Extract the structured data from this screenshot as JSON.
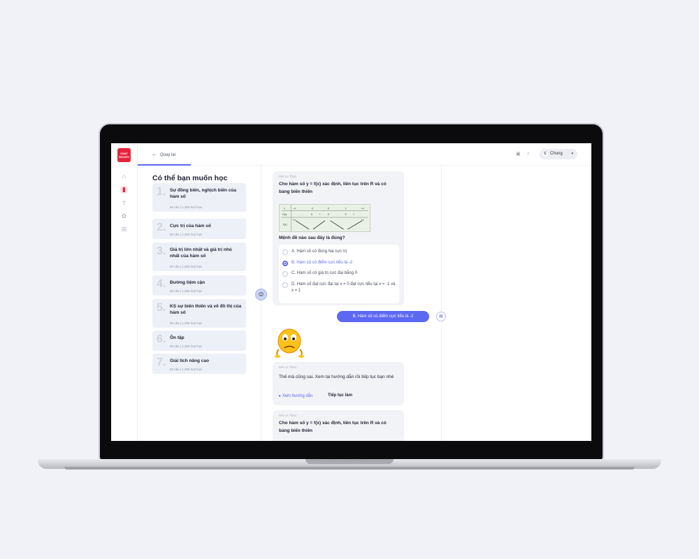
{
  "brand": {
    "logo_line1": "CNAT",
    "logo_line2": "BOOKS"
  },
  "topbar": {
    "back_label": "Quay lại",
    "user_initial": "C",
    "user_name": "Chung",
    "caret": "▾"
  },
  "sidebar": {
    "title": "Có thể bạn muốn học",
    "items": [
      {
        "num": "1.",
        "title": "Sự đồng biến, nghịch biến của hàm số",
        "meta": "50 câu  |  1,250 lượt học"
      },
      {
        "num": "2.",
        "title": "Cực trị của hàm số",
        "meta": "50 câu  |  1,250 lượt học"
      },
      {
        "num": "3.",
        "title": "Giá trị lớn nhất và giá trị nhỏ nhất của hàm số",
        "meta": "50 câu  |  1,250 lượt học"
      },
      {
        "num": "4.",
        "title": "Đường tiệm cận",
        "meta": "50 câu  |  1,250 lượt học"
      },
      {
        "num": "5.",
        "title": "KS sự biến thiên và vẽ đồ thị của hàm số",
        "meta": "50 câu  |  1,250 lượt học"
      },
      {
        "num": "6.",
        "title": "Ôn tập",
        "meta": "50 câu  |  1,250 lượt học"
      },
      {
        "num": "7.",
        "title": "Giải tích nâng cao",
        "meta": "50 câu  |  1,250 lượt học"
      }
    ]
  },
  "chat": {
    "sender": "Mrs Le Thao",
    "question": "Cho hàm số y = f(x) xác định, liên tục trên R và có bảng biến thiên",
    "prompt": "Mệnh đề nào sau đây là đúng?",
    "table": {
      "x_label": "x",
      "fp_label": "f'(x)",
      "f_label": "f(x)",
      "x_vals": [
        "-∞",
        "-1",
        "0",
        "1",
        "+∞"
      ],
      "signs": [
        "-",
        "0",
        "+",
        "0",
        "-",
        "0",
        "+"
      ],
      "top_vals": [
        "+∞",
        "+∞"
      ]
    },
    "options": [
      {
        "label": "A. Hàm số có đúng hai cực trị",
        "selected": false
      },
      {
        "label": "B. Hàm số có điểm cực tiểu là -2",
        "selected": true
      },
      {
        "label": "C. Hàm số có giá trị cực đại bằng 0",
        "selected": false
      },
      {
        "label": "D. Hàm số đạt cực đại tại x = 0 đạt cực tiểu tại x = -1 và x = 1",
        "selected": false
      }
    ],
    "user_answer": "B. Hàm số có điểm cực tiểu là -2",
    "feedback_sender": "Mrs Le Thao",
    "feedback": "Thế mà cũng sai. Xem lại hướng dẫn rồi tiếp tục bạn nhé",
    "guide_link": "Xem hướng dẫn",
    "continue_link": "Tiếp tục làm",
    "next_sender": "Mrs Le Thao",
    "next_question": "Cho hàm số y = f(x) xác định, liên tục trên R và có bảng biến thiên"
  },
  "colors": {
    "accent": "#5c67f2",
    "brand": "#e5243b",
    "card": "#eef0f7"
  }
}
